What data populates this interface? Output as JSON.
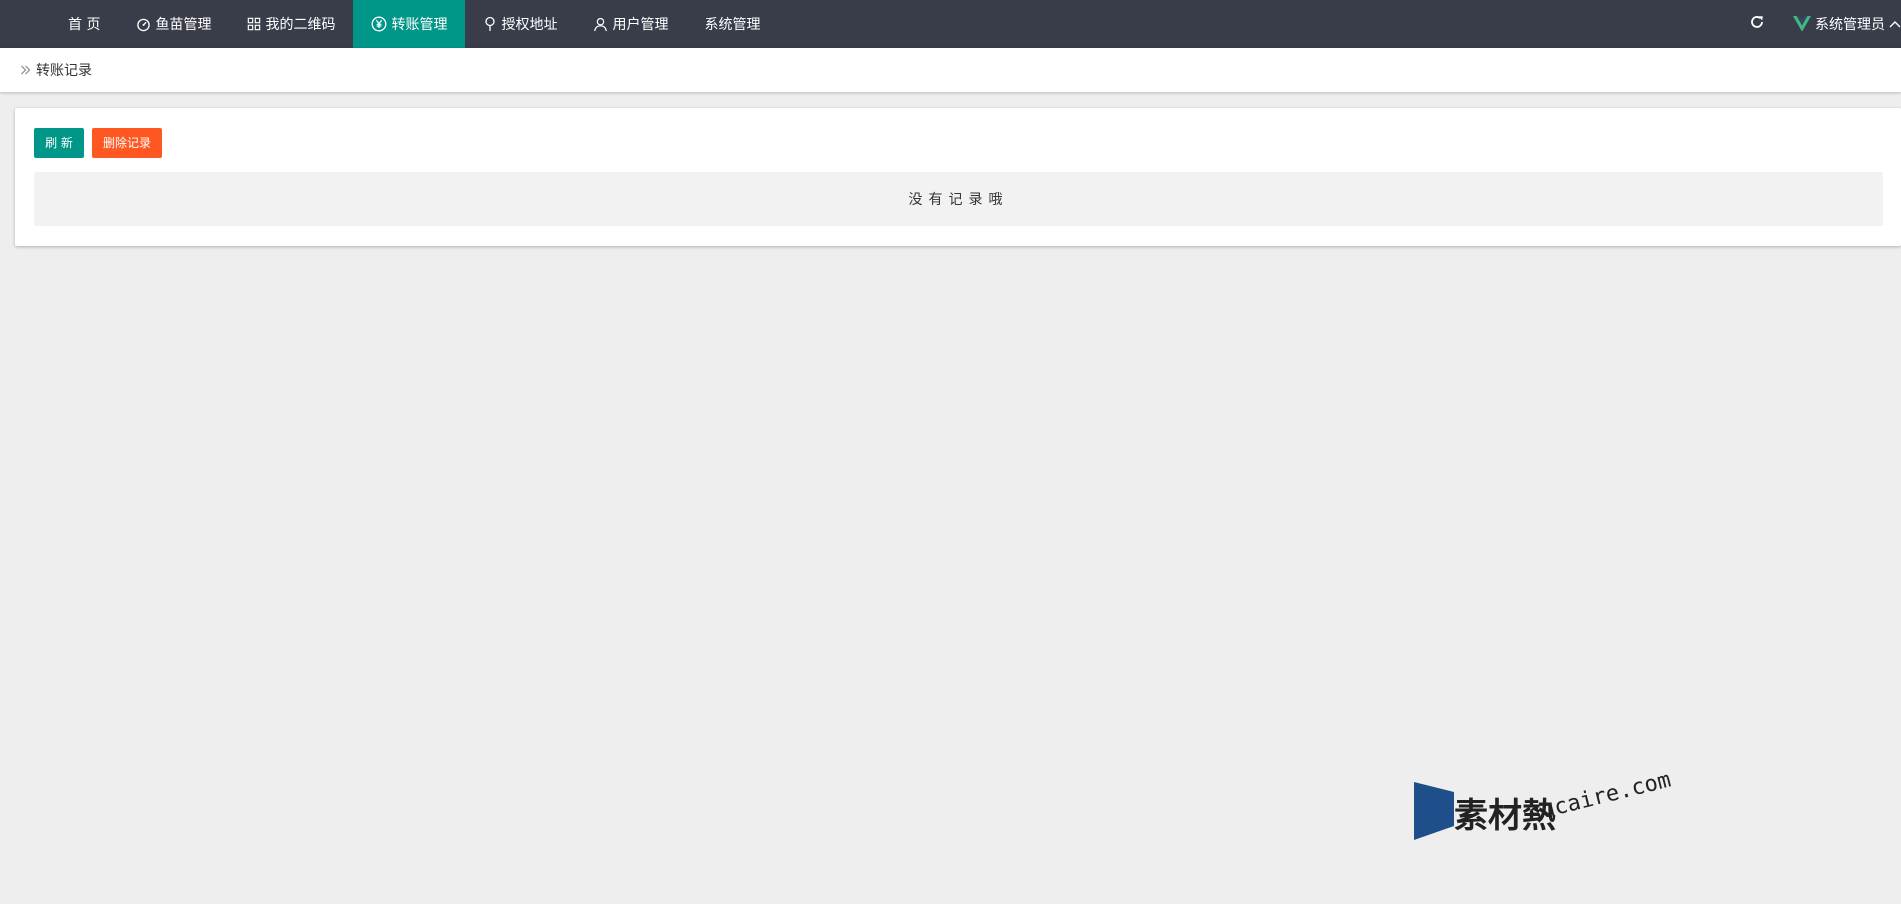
{
  "nav": {
    "items": [
      {
        "label": "首 页",
        "icon": ""
      },
      {
        "label": "鱼苗管理",
        "icon": "dashboard-icon"
      },
      {
        "label": "我的二维码",
        "icon": "app-grid-icon"
      },
      {
        "label": "转账管理",
        "icon": "yen-circle-icon",
        "active": true
      },
      {
        "label": "授权地址",
        "icon": "location-pin-icon"
      },
      {
        "label": "用户管理",
        "icon": "user-icon"
      },
      {
        "label": "系统管理",
        "icon": ""
      }
    ]
  },
  "header": {
    "user_name": "系统管理员"
  },
  "breadcrumb": {
    "current": "转账记录"
  },
  "toolbar": {
    "refresh_label": "刷 新",
    "delete_label": "删除记录"
  },
  "table": {
    "empty_text": "没有记录哦"
  },
  "watermark": {
    "cn": "素材熱",
    "en": "sucaire.com"
  },
  "colors": {
    "topbar_bg": "#393d49",
    "accent": "#009688",
    "danger": "#ff5722",
    "page_bg": "#eeeeee",
    "vue_green": "#41b883"
  }
}
